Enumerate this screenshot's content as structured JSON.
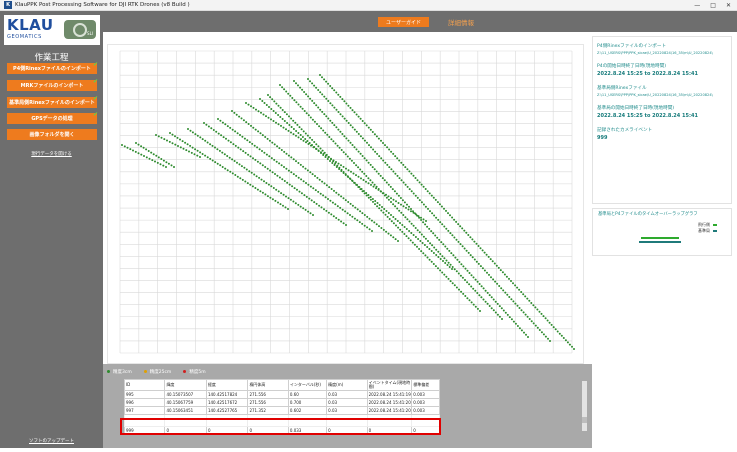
{
  "window": {
    "title": "KlauPPK Post Processing Software for DJI RTK Drones (v8 Build )",
    "controls": [
      "—",
      "□",
      "✕"
    ]
  },
  "logo": {
    "brand": "KLAU",
    "sub": "GEOMATICS",
    "badge": "SLI"
  },
  "sidebar": {
    "section_title": "作業工程",
    "buttons": [
      "P4側Rinexファイルのインポート",
      "MRKファイルのインポート",
      "基準局側Rinexファイルのインポート",
      "GPSデータの処理",
      "画像フォルダを開く"
    ],
    "link_load": "現行データを開ける",
    "link_bottom": "ソフトのアップデート"
  },
  "topbar": {
    "guide_button": "ユーザーガイド",
    "detail_tab": "詳細情報"
  },
  "legend": [
    {
      "label": "精度3cm",
      "color": "#2e8b2e"
    },
    {
      "label": "精度25cm",
      "color": "#e0a000"
    },
    {
      "label": "精度5m",
      "color": "#d02020"
    }
  ],
  "table": {
    "columns": [
      "ID",
      "緯度",
      "経度",
      "楕円体高",
      "インターバル(秒)",
      "精度(m)",
      "イベントタイム(現地時間)",
      "標準偏差"
    ],
    "rows": [
      [
        "995",
        "40.15073507",
        "140.42517824",
        "271.556",
        "0.60",
        "0.03",
        "2022.08.24 15:41:19.40",
        "0.003"
      ],
      [
        "996",
        "40.15067759",
        "140.42517672",
        "271.556",
        "0.700",
        "0.03",
        "2022.08.24 15:41:20.27",
        "0.003"
      ],
      [
        "997",
        "40.15063451",
        "140.42527765",
        "271.352",
        "0.602",
        "0.03",
        "2022.08.24 15:41:20.88",
        "0.003"
      ]
    ],
    "last_row": [
      "999",
      "0",
      "0",
      "0",
      "0.033",
      "0",
      "0",
      "0"
    ]
  },
  "right_panel": {
    "p4_rinex_label": "P4側Rinexファイルのインポート",
    "p4_rinex_value": "Z:\\11_USERS\\PPP\\PPK_sicae\\U_20220824\\16_35\\m\\U_20220824\\",
    "p4_period_label": "P4の開始日時終了日時(現地時間)",
    "p4_period_value": "2022.8.24 15:25 to 2022.8.24 15:41",
    "base_rinex_label": "基準局側Rinexファイル",
    "base_rinex_value": "Z:\\11_USERS\\PPP\\PPK_sicae\\U_20220824\\16_35\\m\\U_20220824\\",
    "base_period_label": "基準局の開始日時終了日時(現地時間)",
    "base_period_value": "2022.8.24 15:25 to 2022.8.24 15:41",
    "events_label": "記録されたカメライベント",
    "events_value": "999",
    "chart_title": "基準局とP4ファイルのタイムオーバーラップグラフ",
    "legend_rover": "飛行側",
    "legend_base": "基準局",
    "color_rover": "#2eaa2e",
    "color_base": "#1f7a7a"
  }
}
